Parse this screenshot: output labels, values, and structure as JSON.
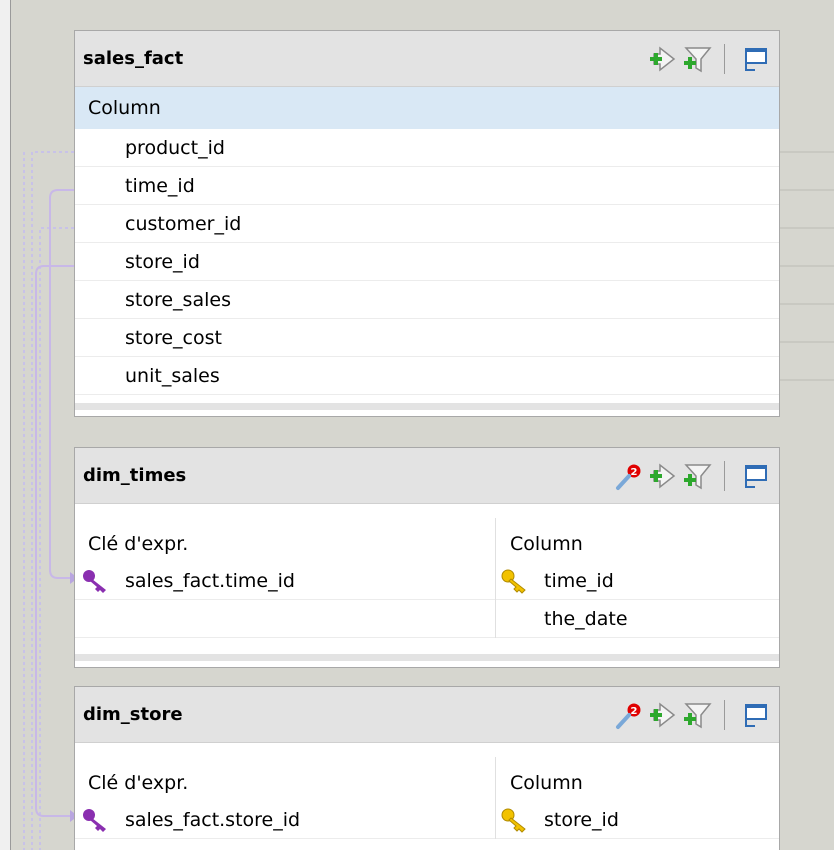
{
  "panels": {
    "sales_fact": {
      "title": "sales_fact",
      "column_header": "Column",
      "rows": [
        "product_id",
        "time_id",
        "customer_id",
        "store_id",
        "store_sales",
        "store_cost",
        "unit_sales"
      ]
    },
    "dim_times": {
      "title": "dim_times",
      "badge": "2",
      "left_header": "Clé d'expr.",
      "right_header": "Column",
      "left_rows": [
        "sales_fact.time_id",
        ""
      ],
      "right_rows": [
        "time_id",
        "the_date"
      ]
    },
    "dim_store": {
      "title": "dim_store",
      "badge": "2",
      "left_header": "Clé d'expr.",
      "right_header": "Column",
      "left_rows": [
        "sales_fact.store_id"
      ],
      "right_rows": [
        "store_id"
      ]
    }
  },
  "icons": {
    "add_input": "add-input-icon",
    "add_filter": "add-filter-icon",
    "minimize": "minimize-icon",
    "expression_key": "expression-key-icon",
    "primary_key": "primary-key-icon",
    "expression_builder": "expression-builder-icon"
  },
  "colors": {
    "header_bg": "#e3e3e3",
    "column_header_bg": "#d9e8f5",
    "connector": "#c8b8e8",
    "expr_key": "#8a2fb0",
    "primary_key": "#e8b800",
    "badge": "#e00000"
  }
}
